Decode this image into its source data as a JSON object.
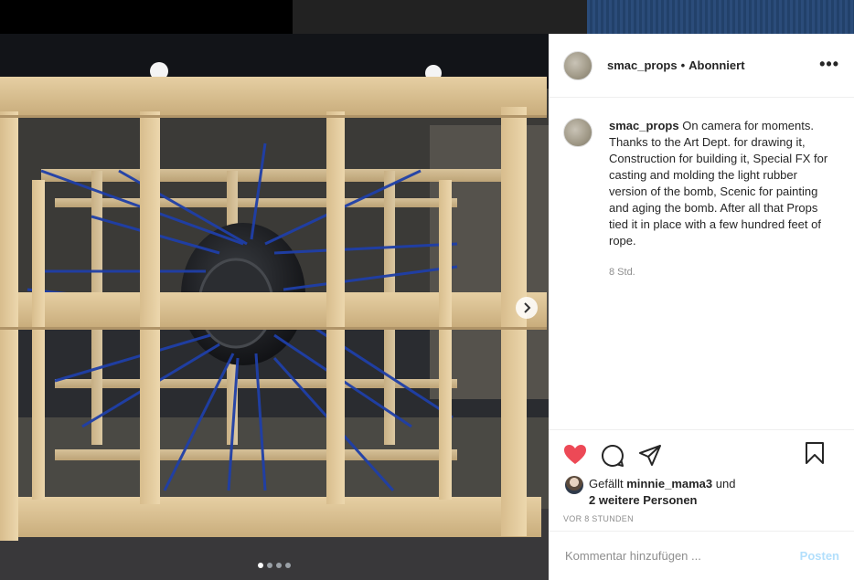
{
  "post": {
    "username": "smac_props",
    "separator": "•",
    "follow_status": "Abonniert",
    "more_label": "•••"
  },
  "caption": {
    "username": "smac_props",
    "text": "On camera for moments. Thanks to the Art Dept. for drawing it, Construction for building it, Special FX for casting and molding the light rubber version of the bomb, Scenic for painting and aging the bomb. After all that Props tied it in place with a few hundred feet of rope.",
    "time": "8 Std."
  },
  "likes": {
    "prefix": "Gefällt",
    "liker": "minnie_mama3",
    "and": "und",
    "others": "2 weitere Personen"
  },
  "timestamp": "VOR 8 STUNDEN",
  "comment": {
    "placeholder": "Kommentar hinzufügen ...",
    "post_label": "Posten"
  },
  "carousel": {
    "slide_count": 4,
    "active_index": 0
  },
  "colors": {
    "like": "#ed4956",
    "post_disabled": "#b2dffc",
    "rope": "#1f3fa8"
  },
  "icons": [
    "heart-icon",
    "comment-icon",
    "share-icon",
    "bookmark-icon",
    "chevron-right-icon",
    "multi-image-icon",
    "more-icon"
  ]
}
